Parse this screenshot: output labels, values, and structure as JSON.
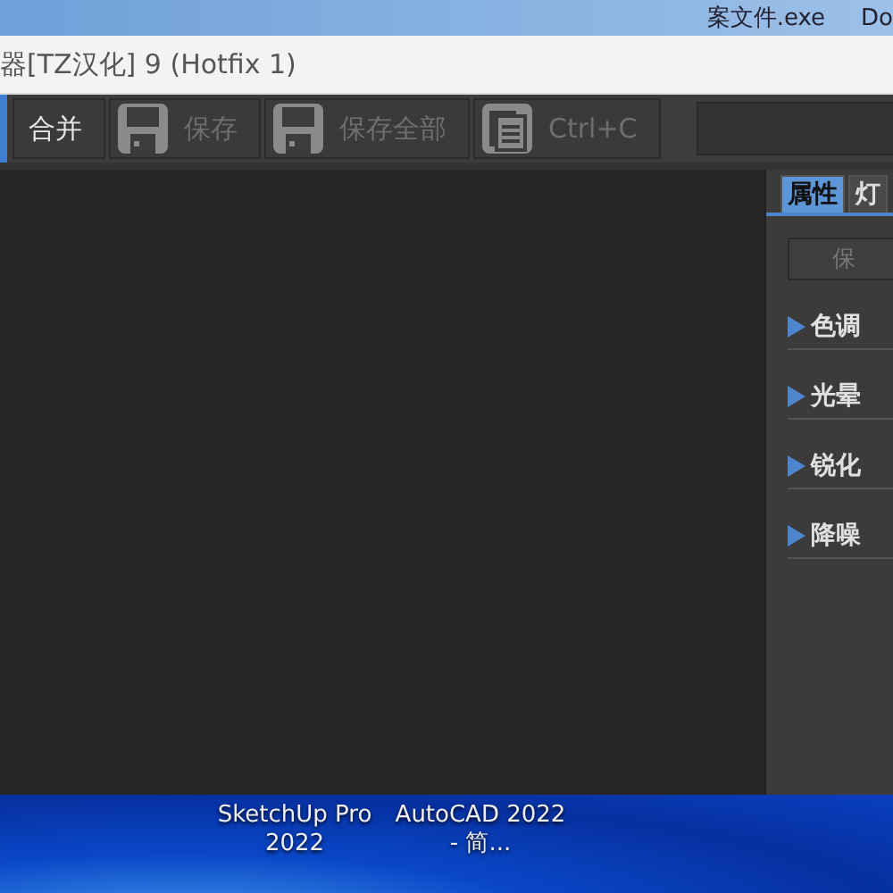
{
  "desktop": {
    "top_labels": [
      "案文件.exe",
      "Do"
    ],
    "icons": [
      {
        "label": "SketchUp Pro 2022"
      },
      {
        "label": "AutoCAD 2022 - 简..."
      }
    ]
  },
  "window": {
    "title": "器[TZ汉化] 9 (Hotfix 1)"
  },
  "toolbar": {
    "buttons": [
      {
        "label": "合并",
        "kind": "text",
        "disabled": false
      },
      {
        "label": "保存",
        "kind": "save",
        "disabled": true
      },
      {
        "label": "保存全部",
        "kind": "save",
        "disabled": true
      },
      {
        "label": "Ctrl+C",
        "kind": "copy",
        "disabled": true
      }
    ]
  },
  "panel": {
    "tabs": [
      {
        "label": "属性",
        "selected": true
      },
      {
        "label": "灯",
        "selected": false
      }
    ],
    "button": "保",
    "sections": [
      {
        "label": "色调",
        "expanded": false
      },
      {
        "label": "光晕",
        "expanded": false
      },
      {
        "label": "锐化",
        "expanded": false
      },
      {
        "label": "降噪",
        "expanded": false
      }
    ]
  }
}
